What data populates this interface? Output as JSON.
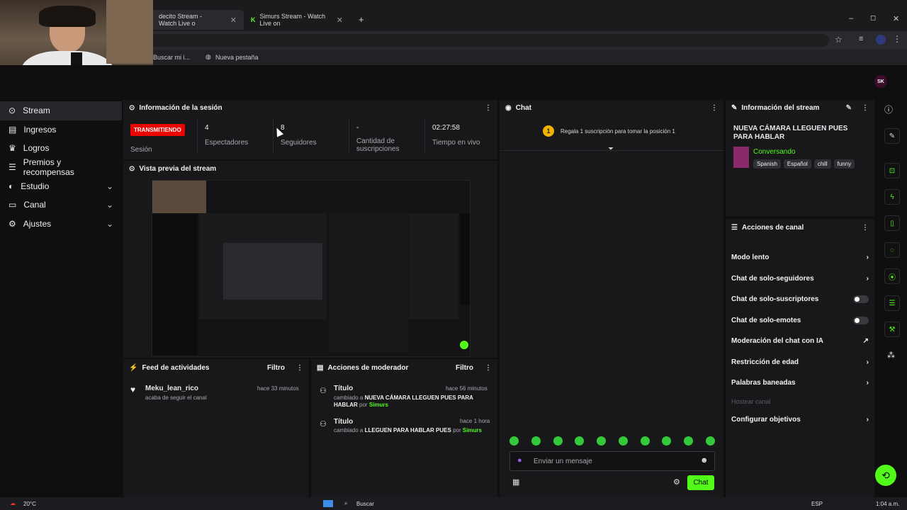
{
  "browser": {
    "tabs": [
      {
        "label": "decito Stream - Watch Live o"
      },
      {
        "label": "Simurs Stream - Watch Live on"
      }
    ],
    "new_tab": "+",
    "bookmarks": [
      {
        "label": "Buscar mi i..."
      },
      {
        "label": "Nueva pestaña"
      }
    ],
    "win_min": "–",
    "win_max": "◻",
    "win_close": "✕"
  },
  "avatar_initials": "SK",
  "sidebar": {
    "items": [
      {
        "label": "Stream",
        "active": true
      },
      {
        "label": "Ingresos"
      },
      {
        "label": "Logros"
      },
      {
        "label": "Premios y recompensas"
      },
      {
        "label": "Estudio",
        "expandable": true
      },
      {
        "label": "Canal",
        "expandable": true
      },
      {
        "label": "Ajustes",
        "expandable": true
      }
    ]
  },
  "session": {
    "title": "Información de la sesión",
    "live_badge": "TRANSMITIENDO",
    "live_label": "Sesión",
    "stats": [
      {
        "value": "4",
        "label": "Espectadores"
      },
      {
        "value": "8",
        "label": "Seguidores"
      },
      {
        "value": "-",
        "label": "Cantidad de suscripciones"
      },
      {
        "value": "02:27:58",
        "label": "Tiempo en vivo"
      }
    ]
  },
  "preview": {
    "title": "Vista previa del stream"
  },
  "feed": {
    "title": "Feed de actividades",
    "filter": "Filtro",
    "items": [
      {
        "user": "Meku_lean_rico",
        "text": "acaba de seguir el canal",
        "time": "hace 33 minutos"
      }
    ]
  },
  "modactions": {
    "title": "Acciones de moderador",
    "filter": "Filtro",
    "items": [
      {
        "heading": "Título",
        "time": "hace 56 minutos",
        "prefix": "cambiado a",
        "value": "NUEVA CÁMARA LLEGUEN PUES PARA HABLAR",
        "by": "por",
        "user": "Simurs"
      },
      {
        "heading": "Título",
        "time": "hace 1 hora",
        "prefix": "cambiado a",
        "value": "LLEGUEN PARA HABLAR PUES",
        "by": "por",
        "user": "Simurs"
      }
    ]
  },
  "chat": {
    "title": "Chat",
    "gift_rank": "1",
    "gift_text": "Regala 1 suscripción para tomar la posición 1",
    "placeholder": "Enviar un mensaje",
    "send": "Chat"
  },
  "streaminfo": {
    "title": "Información del stream",
    "stream_title": "NUEVA CÁMARA LLEGUEN PUES PARA HABLAR",
    "category": "Conversando",
    "tags": [
      "Spanish",
      "Español",
      "chill",
      "funny"
    ]
  },
  "channel_actions": {
    "title": "Acciones de canal",
    "items": [
      {
        "label": "Modo lento",
        "control": "chevron"
      },
      {
        "label": "Chat de solo-seguidores",
        "control": "chevron"
      },
      {
        "label": "Chat de solo-suscriptores",
        "control": "toggle"
      },
      {
        "label": "Chat de solo-emotes",
        "control": "toggle"
      },
      {
        "label": "Moderación del chat con IA",
        "control": "external"
      },
      {
        "label": "Restricción de edad",
        "control": "chevron"
      },
      {
        "label": "Palabras baneadas",
        "control": "chevron"
      },
      {
        "label": "Hostear canal",
        "control": "none",
        "disabled": true
      },
      {
        "label": "Configurar objetivos",
        "control": "chevron"
      }
    ]
  },
  "taskbar": {
    "weather": "20°C",
    "search": "Buscar",
    "lang": "ESP",
    "time": "1:04 a.m."
  },
  "colors": {
    "accent": "#53fc18",
    "live": "#eb0400",
    "panel": "#18181b"
  }
}
